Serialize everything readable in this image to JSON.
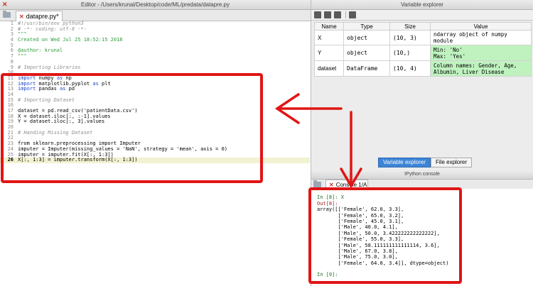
{
  "editor": {
    "window_title": "Editor - /Users/krunal/Desktop/code/ML/predata/datapre.py",
    "tab_label": "datapre.py*",
    "lines": [
      {
        "num": "1",
        "text": "#!/usr/bin/env python3",
        "kind": "comment"
      },
      {
        "num": "2",
        "text": "# -*- coding: utf-8 -*-",
        "kind": "comment"
      },
      {
        "num": "3",
        "text": "\"\"\"",
        "kind": "doc"
      },
      {
        "num": "4",
        "text": "Created on Wed Jul 25 18:52:15 2018",
        "kind": "doc"
      },
      {
        "num": "5",
        "text": "",
        "kind": "plain"
      },
      {
        "num": "6",
        "text": "@author: krunal",
        "kind": "doc"
      },
      {
        "num": "7",
        "text": "\"\"\"",
        "kind": "doc"
      },
      {
        "num": "8",
        "text": "",
        "kind": "plain"
      },
      {
        "num": "9",
        "text": "# Importing Libraries",
        "kind": "comment"
      },
      {
        "num": "10",
        "text": "",
        "kind": "plain"
      },
      {
        "num": "11",
        "text": "import numpy as np",
        "kind": "import"
      },
      {
        "num": "12",
        "text": "import matplotlib.pyplot as plt",
        "kind": "import"
      },
      {
        "num": "13",
        "text": "import pandas as pd",
        "kind": "import"
      },
      {
        "num": "14",
        "text": "",
        "kind": "plain"
      },
      {
        "num": "15",
        "text": "# Importing Dataset",
        "kind": "comment"
      },
      {
        "num": "16",
        "text": "",
        "kind": "plain"
      },
      {
        "num": "17",
        "text": "dataset = pd.read_csv('patientData.csv')",
        "kind": "plain"
      },
      {
        "num": "18",
        "text": "X = dataset.iloc[:, :-1].values",
        "kind": "plain"
      },
      {
        "num": "19",
        "text": "Y = dataset.iloc[:, 3].values",
        "kind": "plain"
      },
      {
        "num": "20",
        "text": "",
        "kind": "plain"
      },
      {
        "num": "21",
        "text": "# Handing Missing Dataset",
        "kind": "comment"
      },
      {
        "num": "22",
        "text": "",
        "kind": "plain"
      },
      {
        "num": "23",
        "text": "from sklearn.preprocessing import Imputer",
        "kind": "plain"
      },
      {
        "num": "24",
        "text": "imputer = Imputer(missing_values = 'NaN', strategy = 'mean', axis = 0)",
        "kind": "plain"
      },
      {
        "num": "25",
        "text": "imputer = imputer.fit(X[:, 1:3])",
        "kind": "plain"
      },
      {
        "num": "26",
        "text": "X[:, 1:3] = imputer.transform(X[:, 1:3])",
        "kind": "current"
      }
    ]
  },
  "variable_explorer": {
    "window_title": "Variable explorer",
    "columns": [
      "Name",
      "Type",
      "Size",
      "Value"
    ],
    "rows": [
      {
        "name": "X",
        "type": "object",
        "size": "(10, 3)",
        "value": "ndarray object of numpy module",
        "green": false
      },
      {
        "name": "Y",
        "type": "object",
        "size": "(10,)",
        "value": "Min: 'No'\nMax: 'Yes'",
        "green": true
      },
      {
        "name": "dataset",
        "type": "DataFrame",
        "size": "(10, 4)",
        "value": "Column names: Gender, Age, Albumin, Liver Disease",
        "green": true
      }
    ],
    "tab_variable_explorer": "Variable explorer",
    "tab_file_explorer": "File explorer"
  },
  "console": {
    "window_title": "IPython console",
    "tab_label": "Console 1/A",
    "lines": [
      {
        "text": "",
        "cls": ""
      },
      {
        "text": "In [8]: X",
        "cls": "prompt"
      },
      {
        "text": "Out[8]:",
        "cls": "out"
      },
      {
        "text": "array([['Female', 62.0, 3.3],",
        "cls": ""
      },
      {
        "text": "       ['Female', 65.0, 3.2],",
        "cls": ""
      },
      {
        "text": "       ['Female', 45.0, 3.1],",
        "cls": ""
      },
      {
        "text": "       ['Male', 40.0, 4.1],",
        "cls": ""
      },
      {
        "text": "       ['Male', 50.0, 3.422222222222222],",
        "cls": ""
      },
      {
        "text": "       ['Female', 55.0, 3.3],",
        "cls": ""
      },
      {
        "text": "       ['Male', 58.111111111111114, 3.6],",
        "cls": ""
      },
      {
        "text": "       ['Male', 67.0, 3.8],",
        "cls": ""
      },
      {
        "text": "       ['Male', 75.0, 3.0],",
        "cls": ""
      },
      {
        "text": "       ['Female', 64.0, 3.4]], dtype=object)",
        "cls": ""
      },
      {
        "text": "",
        "cls": ""
      },
      {
        "text": "In [9]:",
        "cls": "prompt"
      }
    ]
  },
  "colors": {
    "highlight_red": "#e01515",
    "green_cell": "#bff2bf"
  }
}
